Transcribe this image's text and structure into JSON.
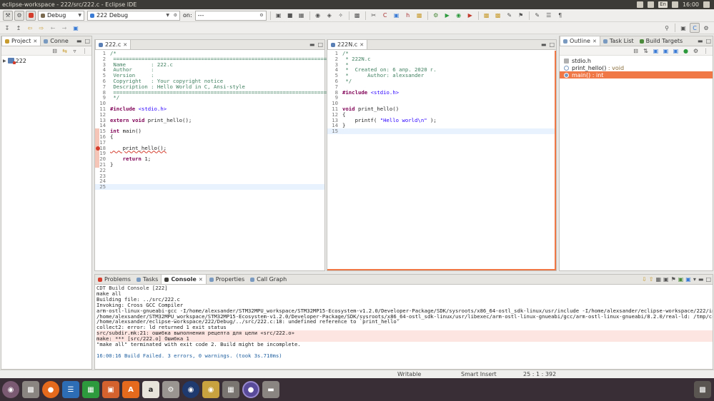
{
  "window": {
    "title": "eclipse-workspace - 222/src/222.c - Eclipse IDE",
    "lang": "En",
    "clock": "16:00"
  },
  "toolbar": {
    "build_config": "Debug",
    "launch_config": "222 Debug",
    "on_label": "on:",
    "target": "---"
  },
  "project_panel": {
    "tabs": [
      {
        "label": "Project"
      },
      {
        "label": "Conne"
      }
    ],
    "tree": [
      {
        "label": "222"
      }
    ]
  },
  "editor_left": {
    "tab": "222.c",
    "lines": [
      {
        "n": "1",
        "t": "/*"
      },
      {
        "n": "2",
        "t": " ============================================================================"
      },
      {
        "n": "3",
        "t": " Name        : 222.c"
      },
      {
        "n": "4",
        "t": " Author      :"
      },
      {
        "n": "5",
        "t": " Version     :"
      },
      {
        "n": "6",
        "t": " Copyright   : Your copyright notice"
      },
      {
        "n": "7",
        "t": " Description : Hello World in C, Ansi-style"
      },
      {
        "n": "8",
        "t": " ============================================================================"
      },
      {
        "n": "9",
        "t": " */"
      },
      {
        "n": "10",
        "t": ""
      },
      {
        "n": "11",
        "t": "#include <stdio.h>"
      },
      {
        "n": "12",
        "t": ""
      },
      {
        "n": "13",
        "t": "extern void print_hello();"
      },
      {
        "n": "14",
        "t": ""
      },
      {
        "n": "15",
        "t": "int main()"
      },
      {
        "n": "16",
        "t": "{"
      },
      {
        "n": "17",
        "t": ""
      },
      {
        "n": "18",
        "t": "    print_hello();"
      },
      {
        "n": "19",
        "t": ""
      },
      {
        "n": "20",
        "t": "    return 1;"
      },
      {
        "n": "21",
        "t": "}"
      },
      {
        "n": "22",
        "t": ""
      },
      {
        "n": "23",
        "t": ""
      },
      {
        "n": "24",
        "t": ""
      },
      {
        "n": "25",
        "t": ""
      }
    ]
  },
  "editor_right": {
    "tab": "222N.c",
    "lines": [
      {
        "n": "1",
        "t": "/*"
      },
      {
        "n": "2",
        "t": " * 222N.c"
      },
      {
        "n": "3",
        "t": " *"
      },
      {
        "n": "4",
        "t": " *  Created on: 6 апр. 2020 г."
      },
      {
        "n": "5",
        "t": " *      Author: alexsander"
      },
      {
        "n": "6",
        "t": " */"
      },
      {
        "n": "7",
        "t": ""
      },
      {
        "n": "8",
        "t": "#include <stdio.h>"
      },
      {
        "n": "9",
        "t": ""
      },
      {
        "n": "10",
        "t": ""
      },
      {
        "n": "11",
        "t": "void print_hello()"
      },
      {
        "n": "12",
        "t": "{"
      },
      {
        "n": "13",
        "t": "    printf( \"Hello world\\n\" );"
      },
      {
        "n": "14",
        "t": "}"
      },
      {
        "n": "15",
        "t": ""
      }
    ]
  },
  "outline_panel": {
    "tabs": [
      {
        "label": "Outline"
      },
      {
        "label": "Task List"
      },
      {
        "label": "Build Targets"
      }
    ],
    "items": [
      {
        "label": "stdio.h",
        "suffix": ""
      },
      {
        "label": "print_hello()",
        "suffix": " : void"
      },
      {
        "label": "main()",
        "suffix": " : int"
      }
    ]
  },
  "bottom_panel": {
    "tabs": [
      {
        "label": "Problems"
      },
      {
        "label": "Tasks"
      },
      {
        "label": "Console"
      },
      {
        "label": "Properties"
      },
      {
        "label": "Call Graph"
      }
    ],
    "console_title": "CDT Build Console [222]",
    "lines": [
      {
        "t": "make all",
        "kind": "normal"
      },
      {
        "t": "Building file: ../src/222.c",
        "kind": "normal"
      },
      {
        "t": "Invoking: Cross GCC Compiler",
        "kind": "normal"
      },
      {
        "t": "arm-ostl-linux-gnueabi-gcc -I/home/alexsander/STM32MPU_workspace/STM32MP15-Ecosystem-v1.2.0/Developer-Package/SDK/sysroots/x86_64-ostl_sdk-linux/usr/include -I/home/alexsander/eclipse-workspace/222/inc -O0 -g3",
        "kind": "normal"
      },
      {
        "t": "/home/alexsander/STM32MPU_workspace/STM32MP15-Ecosystem-v1.2.0/Developer-Package/SDK/sysroots/x86_64-ostl_sdk-linux/usr/libexec/arm-ostl-linux-gnueabi/gcc/arm-ostl-linux-gnueabi/8.2.0/real-ld: /tmp/ccpDNkoV.o",
        "kind": "normal"
      },
      {
        "t": "/home/alexsander/eclipse-workspace/222/Debug/../src/222.c:18: undefined reference to `print_hello'",
        "kind": "normal"
      },
      {
        "t": "collect2: error: ld returned 1 exit status",
        "kind": "normal"
      },
      {
        "t": "src/subdir.mk:21: ошибка выполнения рецепта для цели «src/222.o»",
        "kind": "error"
      },
      {
        "t": "make: *** [src/222.o] Ошибка 1",
        "kind": "error"
      },
      {
        "t": "\"make all\" terminated with exit code 2. Build might be incomplete.",
        "kind": "normal"
      },
      {
        "t": "",
        "kind": "normal"
      },
      {
        "t": "16:00:16 Build Failed. 3 errors, 0 warnings. (took 3s.710ms)",
        "kind": "built"
      }
    ]
  },
  "statusbar": {
    "mode": "Writable",
    "insert": "Smart Insert",
    "position": "25 : 1 : 392"
  },
  "colors": {
    "selection": "#f07746",
    "titlebar": "#3c3b37",
    "dock": "#3a2e36"
  }
}
